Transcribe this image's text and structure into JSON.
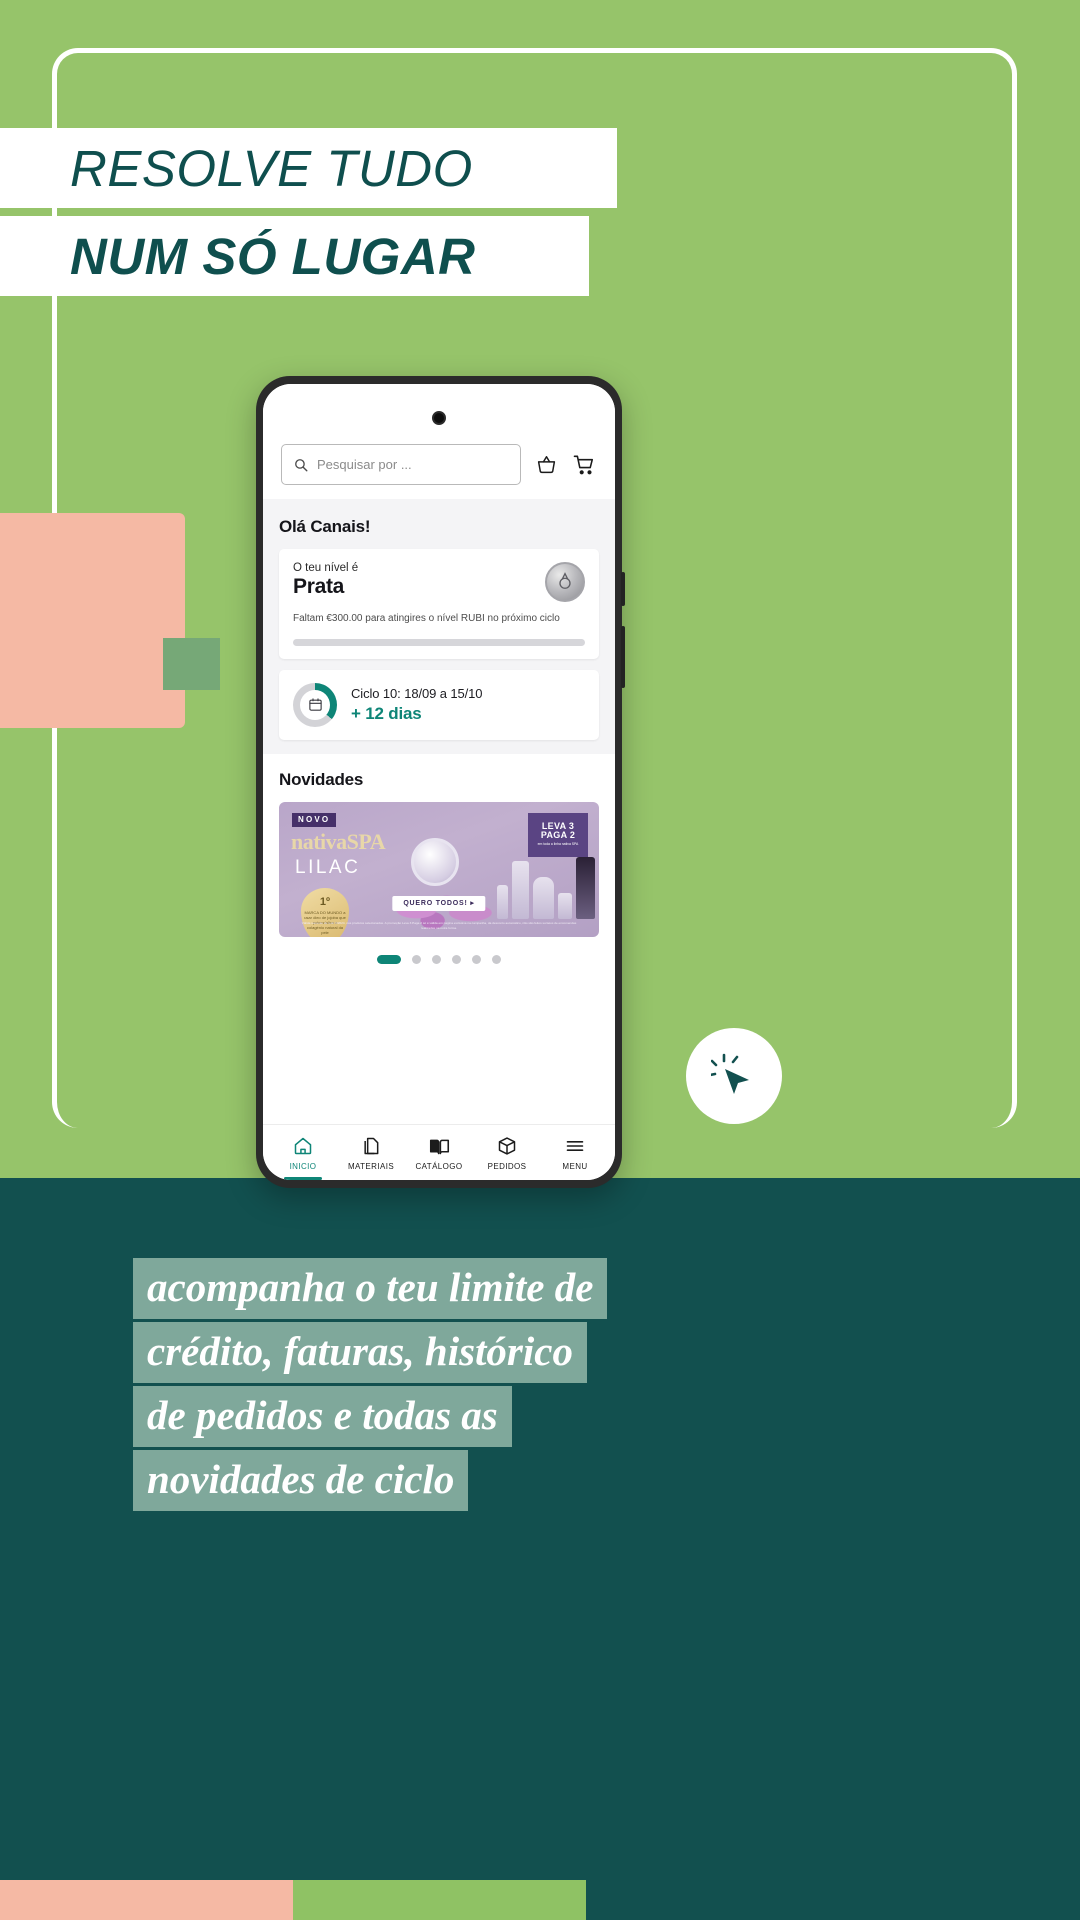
{
  "poster": {
    "headline_line1": "RESOLVE TUDO",
    "headline_line2": "NUM SÓ LUGAR",
    "caption_lines": [
      "acompanha o teu limite de",
      "crédito, faturas, histórico",
      "de pedidos e todas as",
      "novidades de ciclo"
    ],
    "colors": {
      "green": "#96c46a",
      "teal": "#12504f",
      "peach": "#f5b9a4",
      "sage": "#76a877",
      "headline_text": "#0f4f4e",
      "caption_bg": "#7fa89b",
      "accent_teal": "#0e8577"
    }
  },
  "click_badge": {
    "icon": "cursor-click-icon"
  },
  "app": {
    "search": {
      "placeholder": "Pesquisar por ...",
      "value": "",
      "icon": "search-icon"
    },
    "header_icons": [
      {
        "name": "basket-icon",
        "glyph": "basket"
      },
      {
        "name": "cart-icon",
        "glyph": "cart"
      }
    ],
    "greeting": "Olá Canais!",
    "level_card": {
      "label": "O teu nível é",
      "level": "Prata",
      "description": "Faltam €300.00 para atingires o nível RUBI no próximo ciclo",
      "progress_percent": 0,
      "medal_icon": "medal-icon"
    },
    "cycle_card": {
      "title": "Ciclo 10: 18/09 a 15/10",
      "days_remaining": "+ 12 dias",
      "progress_percent": 36,
      "icon": "calendar-icon"
    },
    "news": {
      "title": "Novidades",
      "banner": {
        "tag": "NOVO",
        "brand": "nativaSPA",
        "subtitle": "LILAC",
        "seal_number": "1º",
        "seal_text": "MARCA DO MUNDO a usar óleo de jojoba que potencializa o colagénio natural da pele",
        "promo_line1": "LEVA 3",
        "promo_line2": "PAGA 2",
        "promo_note": "em toda a linha nativa SPA",
        "cta": "QUERO TODOS! ▸",
        "legal": "Válida somente de todo 9/2024, nos produtos selecionados. A promoção Leva 3 Paga 2 só é válida em pagina exclusiva na campanha, da desconto automático, não são feitos sorteios de encomendas realizadas na outra forma."
      },
      "carousel": {
        "total_dots": 6,
        "active_index": 0
      }
    },
    "bottom_nav": [
      {
        "label": "INICIO",
        "icon": "home-icon",
        "active": true
      },
      {
        "label": "MATERIAIS",
        "icon": "documents-icon",
        "active": false
      },
      {
        "label": "CATÁLOGO",
        "icon": "book-icon",
        "active": false
      },
      {
        "label": "PEDIDOS",
        "icon": "box-icon",
        "active": false
      },
      {
        "label": "MENU",
        "icon": "hamburger-icon",
        "active": false
      }
    ]
  }
}
